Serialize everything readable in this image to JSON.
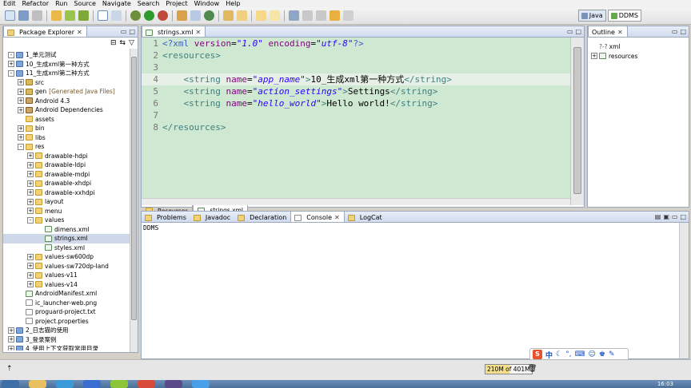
{
  "menubar": {
    "items": [
      {
        "label": "Edit"
      },
      {
        "label": "Refactor"
      },
      {
        "label": "Run"
      },
      {
        "label": "Source"
      },
      {
        "label": "Navigate"
      },
      {
        "label": "Search"
      },
      {
        "label": "Project"
      },
      {
        "label": "Window"
      },
      {
        "label": "Help"
      }
    ]
  },
  "toolbar": {
    "perspectives": [
      {
        "label": "Java",
        "icon": "java-perspective-icon",
        "active": true
      },
      {
        "label": "DDMS",
        "icon": "ddms-perspective-icon",
        "active": false
      }
    ]
  },
  "package_explorer": {
    "title": "Package Explorer",
    "rows": [
      {
        "indent": 0,
        "twisty": "-",
        "icon": "proj",
        "label": "1_单元测试"
      },
      {
        "indent": 0,
        "twisty": "+",
        "icon": "proj",
        "label": "10_生成xml第一种方式"
      },
      {
        "indent": 0,
        "twisty": "-",
        "icon": "proj",
        "label": "11_生成xml第二种方式"
      },
      {
        "indent": 1,
        "twisty": "+",
        "icon": "pkgf",
        "label": "src"
      },
      {
        "indent": 1,
        "twisty": "+",
        "icon": "pkgf",
        "label": "gen",
        "decoration": "[Generated Java Files]"
      },
      {
        "indent": 1,
        "twisty": "+",
        "icon": "lib",
        "label": "Android 4.3"
      },
      {
        "indent": 1,
        "twisty": "+",
        "icon": "lib",
        "label": "Android Dependencies"
      },
      {
        "indent": 1,
        "twisty": "",
        "icon": "folder",
        "label": "assets"
      },
      {
        "indent": 1,
        "twisty": "+",
        "icon": "folder",
        "label": "bin"
      },
      {
        "indent": 1,
        "twisty": "+",
        "icon": "folder",
        "label": "libs"
      },
      {
        "indent": 1,
        "twisty": "-",
        "icon": "folder",
        "label": "res"
      },
      {
        "indent": 2,
        "twisty": "+",
        "icon": "folder",
        "label": "drawable-hdpi"
      },
      {
        "indent": 2,
        "twisty": "+",
        "icon": "folder",
        "label": "drawable-ldpi"
      },
      {
        "indent": 2,
        "twisty": "+",
        "icon": "folder",
        "label": "drawable-mdpi"
      },
      {
        "indent": 2,
        "twisty": "+",
        "icon": "folder",
        "label": "drawable-xhdpi"
      },
      {
        "indent": 2,
        "twisty": "+",
        "icon": "folder",
        "label": "drawable-xxhdpi"
      },
      {
        "indent": 2,
        "twisty": "+",
        "icon": "folder",
        "label": "layout"
      },
      {
        "indent": 2,
        "twisty": "+",
        "icon": "folder",
        "label": "menu"
      },
      {
        "indent": 2,
        "twisty": "-",
        "icon": "folder",
        "label": "values"
      },
      {
        "indent": 3,
        "twisty": "",
        "icon": "xml",
        "label": "dimens.xml"
      },
      {
        "indent": 3,
        "twisty": "",
        "icon": "xml",
        "label": "strings.xml",
        "selected": true
      },
      {
        "indent": 3,
        "twisty": "",
        "icon": "xml",
        "label": "styles.xml"
      },
      {
        "indent": 2,
        "twisty": "+",
        "icon": "folder",
        "label": "values-sw600dp"
      },
      {
        "indent": 2,
        "twisty": "+",
        "icon": "folder",
        "label": "values-sw720dp-land"
      },
      {
        "indent": 2,
        "twisty": "+",
        "icon": "folder",
        "label": "values-v11"
      },
      {
        "indent": 2,
        "twisty": "+",
        "icon": "folder",
        "label": "values-v14"
      },
      {
        "indent": 1,
        "twisty": "",
        "icon": "xml",
        "label": "AndroidManifest.xml"
      },
      {
        "indent": 1,
        "twisty": "",
        "icon": "file",
        "label": "ic_launcher-web.png"
      },
      {
        "indent": 1,
        "twisty": "",
        "icon": "file",
        "label": "proguard-project.txt"
      },
      {
        "indent": 1,
        "twisty": "",
        "icon": "file",
        "label": "project.properties"
      },
      {
        "indent": 0,
        "twisty": "+",
        "icon": "proj",
        "label": "2_日志猫的使用"
      },
      {
        "indent": 0,
        "twisty": "+",
        "icon": "proj",
        "label": "3_登录案例"
      },
      {
        "indent": 0,
        "twisty": "+",
        "icon": "proj",
        "label": "4_使用上下文获取常用目录"
      }
    ]
  },
  "editor": {
    "tab_label": "strings.xml",
    "bottom_tabs": [
      {
        "label": "Resources",
        "active": false
      },
      {
        "label": "strings.xml",
        "active": true
      }
    ],
    "lines": [
      {
        "no": "1",
        "segments": [
          [
            "pi",
            "<?xml "
          ],
          [
            "attr",
            "version"
          ],
          [
            "txt",
            "="
          ],
          [
            "str",
            "\"1.0\""
          ],
          [
            "attr",
            " encoding"
          ],
          [
            "txt",
            "="
          ],
          [
            "str",
            "\"utf-8\""
          ],
          [
            "pi",
            "?>"
          ]
        ]
      },
      {
        "no": "2",
        "segments": [
          [
            "tag",
            "<resources>"
          ]
        ]
      },
      {
        "no": "3",
        "segments": []
      },
      {
        "no": "4",
        "current": true,
        "segments": [
          [
            "txt",
            "    "
          ],
          [
            "tag",
            "<string "
          ],
          [
            "attr",
            "name"
          ],
          [
            "txt",
            "="
          ],
          [
            "str",
            "\"app_name\""
          ],
          [
            "tag",
            ">"
          ],
          [
            "txt",
            "10_生成xml第一种方式"
          ],
          [
            "tag",
            "</string>"
          ]
        ]
      },
      {
        "no": "5",
        "segments": [
          [
            "txt",
            "    "
          ],
          [
            "tag",
            "<string "
          ],
          [
            "attr",
            "name"
          ],
          [
            "txt",
            "="
          ],
          [
            "str",
            "\"action_settings\""
          ],
          [
            "tag",
            ">"
          ],
          [
            "txt",
            "Settings"
          ],
          [
            "tag",
            "</string>"
          ]
        ]
      },
      {
        "no": "6",
        "segments": [
          [
            "txt",
            "    "
          ],
          [
            "tag",
            "<string "
          ],
          [
            "attr",
            "name"
          ],
          [
            "txt",
            "="
          ],
          [
            "str",
            "\"hello_world\""
          ],
          [
            "tag",
            ">"
          ],
          [
            "txt",
            "Hello world!"
          ],
          [
            "tag",
            "</string>"
          ]
        ]
      },
      {
        "no": "7",
        "segments": []
      },
      {
        "no": "8",
        "segments": [
          [
            "tag",
            "</resources>"
          ]
        ]
      }
    ]
  },
  "outline": {
    "title": "Outline",
    "rows": [
      {
        "indent": 0,
        "twisty": "",
        "label": "xml",
        "prefix": "?-?"
      },
      {
        "indent": 0,
        "twisty": "+",
        "label": "resources",
        "prefix": ""
      }
    ]
  },
  "console": {
    "tabs": [
      {
        "label": "Problems",
        "icon": "problems-icon",
        "active": false
      },
      {
        "label": "Javadoc",
        "icon": "javadoc-icon",
        "active": false
      },
      {
        "label": "Declaration",
        "icon": "declaration-icon",
        "active": false
      },
      {
        "label": "Console",
        "icon": "console-icon",
        "active": true
      },
      {
        "label": "LogCat",
        "icon": "logcat-icon",
        "active": false
      }
    ],
    "output": "DDMS"
  },
  "status": {
    "heap": "210M of 401M",
    "heap_used_fraction": 0.52,
    "ime_lang": "中"
  },
  "taskbar": {
    "clock": "16:03"
  },
  "colors": {
    "editor_bg": "#cfe8d2",
    "selection": "#cfd8e8"
  }
}
